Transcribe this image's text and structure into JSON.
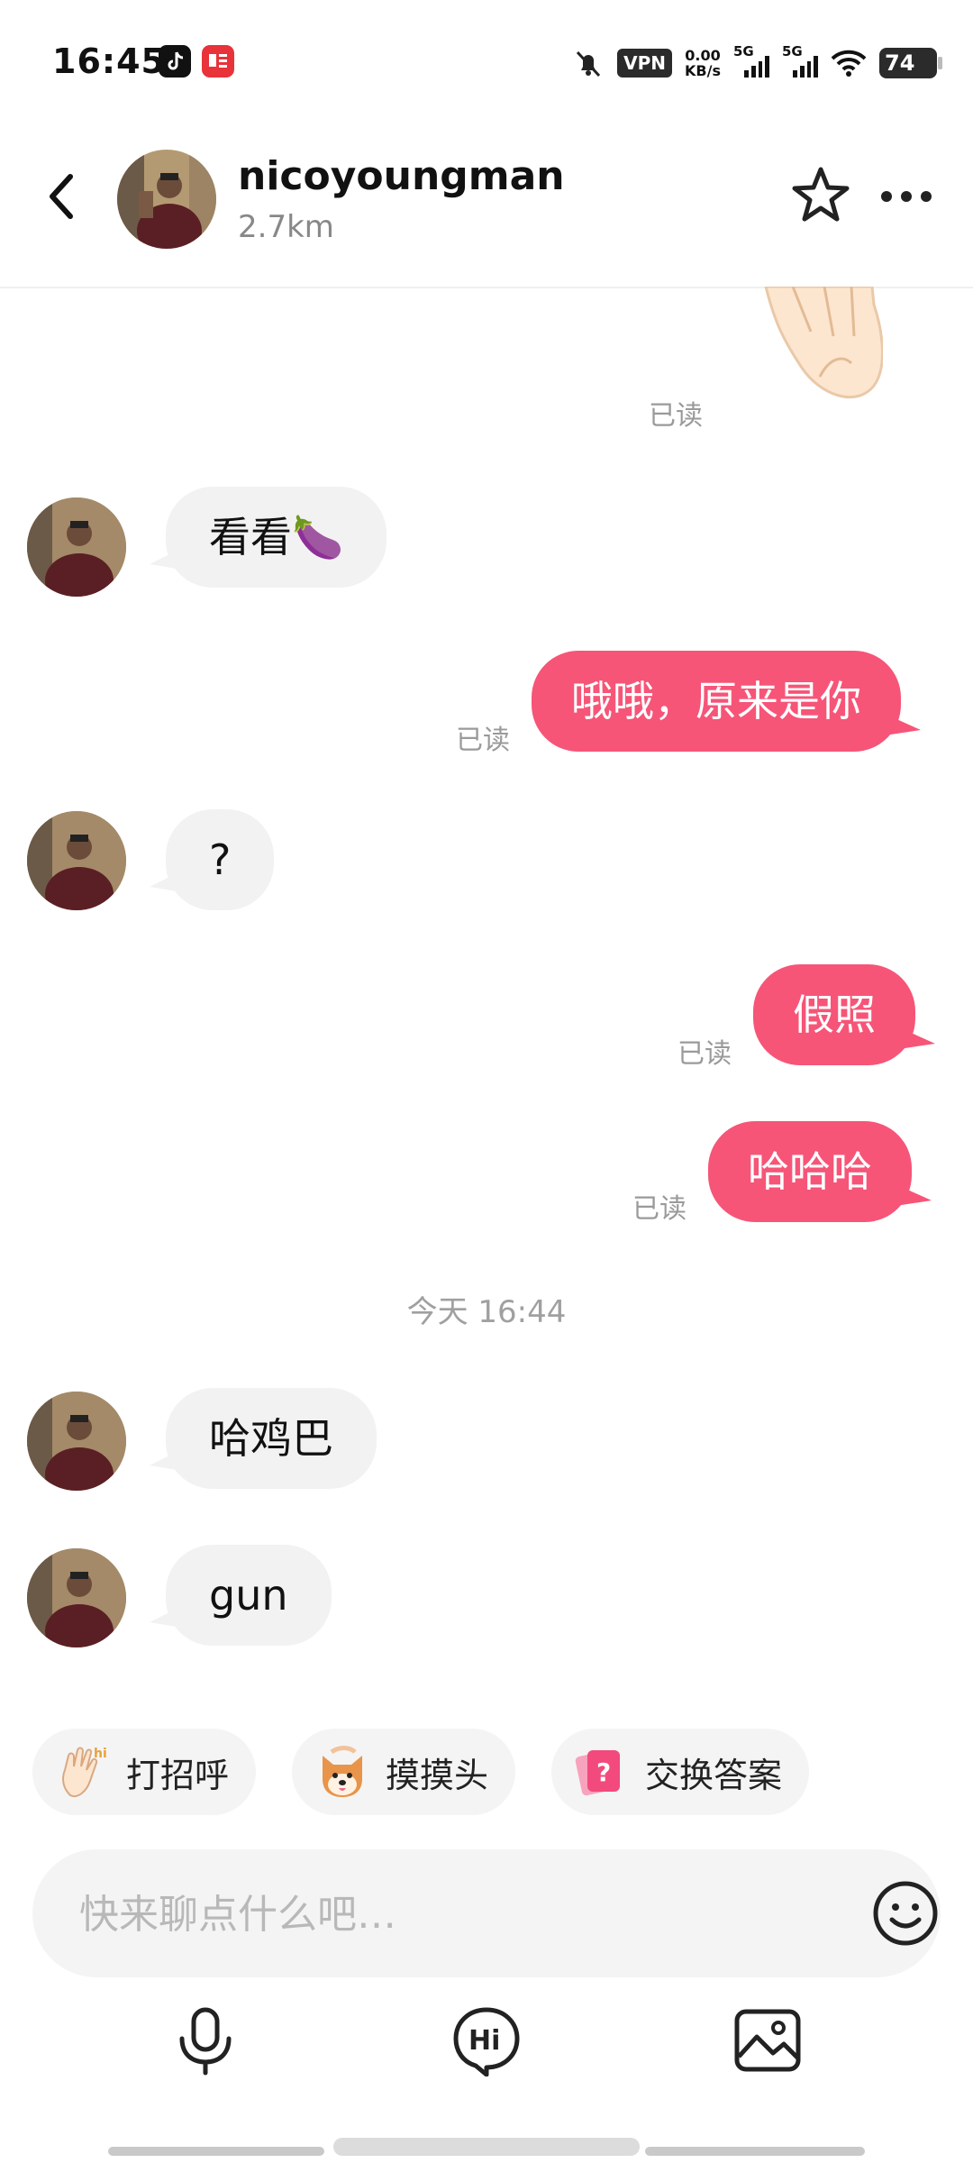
{
  "status_bar": {
    "time": "16:45",
    "vpn": "VPN",
    "net_speed_value": "0.00",
    "net_speed_unit": "KB/s",
    "signal1": "5G",
    "signal2": "5G",
    "battery": "74"
  },
  "header": {
    "name": "nicoyoungman",
    "distance": "2.7km"
  },
  "messages": [
    {
      "side": "out",
      "type": "sticker",
      "sticker": "waving-hand",
      "read": "已读"
    },
    {
      "side": "in",
      "text": "看看🍆"
    },
    {
      "side": "out",
      "text": "哦哦，原来是你",
      "read": "已读"
    },
    {
      "side": "in",
      "text": "?"
    },
    {
      "side": "out",
      "text": "假照",
      "read": "已读"
    },
    {
      "side": "out",
      "text": "哈哈哈",
      "read": "已读"
    },
    {
      "type": "timestamp",
      "text": "今天 16:44"
    },
    {
      "side": "in",
      "text": "哈鸡巴"
    },
    {
      "side": "in",
      "text": "gun"
    }
  ],
  "quick_replies": [
    {
      "label": "打招呼",
      "icon": "wave-hi-icon"
    },
    {
      "label": "摸摸头",
      "icon": "shiba-dog-icon"
    },
    {
      "label": "交换答案",
      "icon": "question-card-icon"
    }
  ],
  "composer": {
    "placeholder": "快来聊点什么吧…",
    "emoji_icon": "smiley-icon"
  },
  "toolbar": [
    "microphone-icon",
    "hi-bubble-icon",
    "image-icon"
  ],
  "colors": {
    "outgoing_bubble": "#f65578",
    "incoming_bubble": "#f2f2f2",
    "read_text": "#9a9a9a"
  }
}
